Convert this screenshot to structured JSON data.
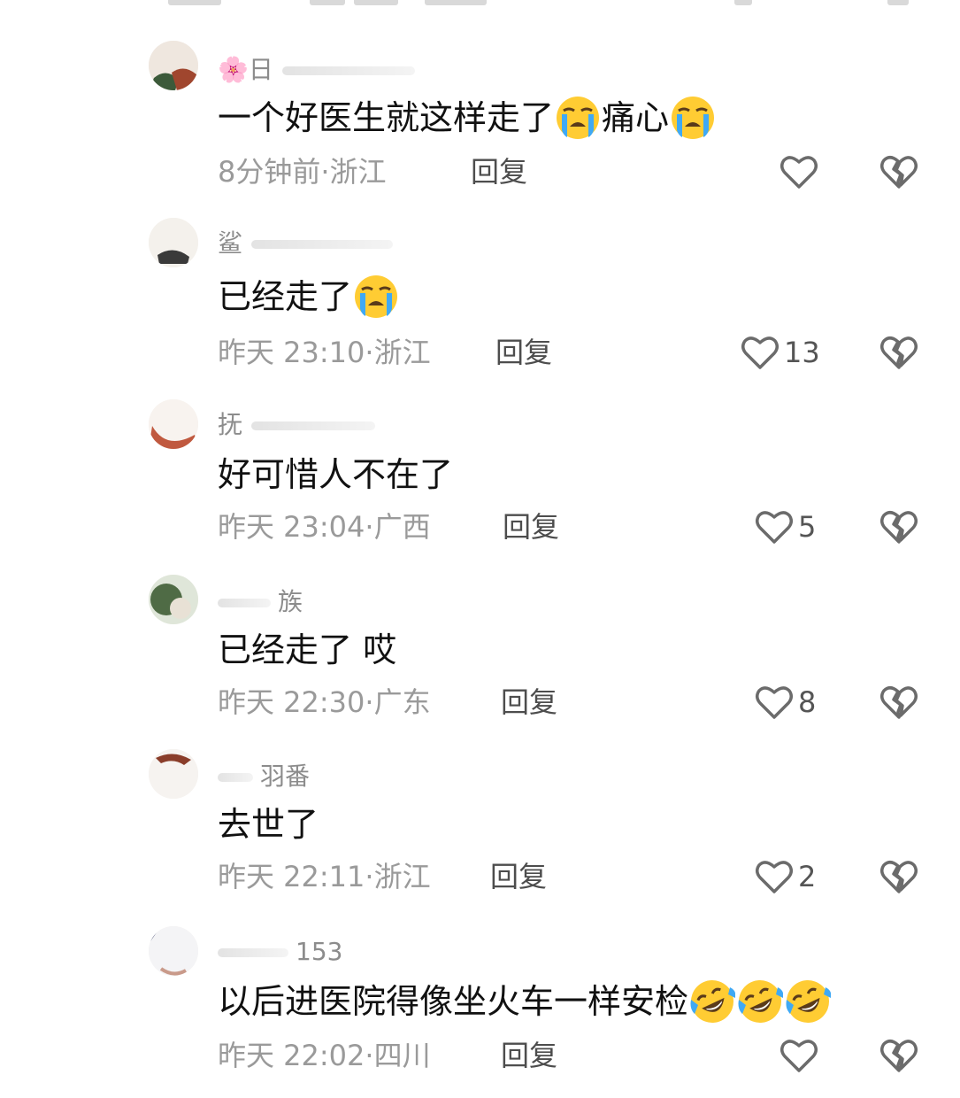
{
  "comments": [
    {
      "user": "🌸日",
      "text": "一个好医生就这样走了",
      "text_part2": "痛心",
      "emoji": [
        "loudly-crying-face",
        "loudly-crying-face"
      ],
      "time": "8分钟前",
      "region": "浙江",
      "reply": "回复",
      "likes": ""
    },
    {
      "user": "鲨",
      "text": "已经走了",
      "emoji": [
        "loudly-crying-face"
      ],
      "time": "昨天 23:10",
      "region": "浙江",
      "reply": "回复",
      "likes": "13"
    },
    {
      "user": "抚",
      "text": "好可惜人不在了",
      "emoji": [],
      "time": "昨天 23:04",
      "region": "广西",
      "reply": "回复",
      "likes": "5"
    },
    {
      "user": "族",
      "text": "已经走了 哎",
      "emoji": [],
      "time": "昨天 22:30",
      "region": "广东",
      "reply": "回复",
      "likes": "8"
    },
    {
      "user": "羽番",
      "text": "去世了",
      "emoji": [],
      "time": "昨天 22:11",
      "region": "浙江",
      "reply": "回复",
      "likes": "2"
    },
    {
      "user": "153",
      "text": "以后进医院得像坐火车一样安检",
      "emoji": [
        "rolling-on-floor-laughing-face",
        "rolling-on-floor-laughing-face",
        "rolling-on-floor-laughing-face"
      ],
      "time": "昨天 22:02",
      "region": "四川",
      "reply": "回复",
      "likes": ""
    }
  ],
  "separator": "·",
  "icons": {
    "like": "heart-outline-icon",
    "dislike": "broken-heart-icon"
  },
  "colors": {
    "text": "#111111",
    "meta": "#9a9a9a",
    "reply": "#4d4d4d",
    "icon": "#6b6b6b"
  }
}
